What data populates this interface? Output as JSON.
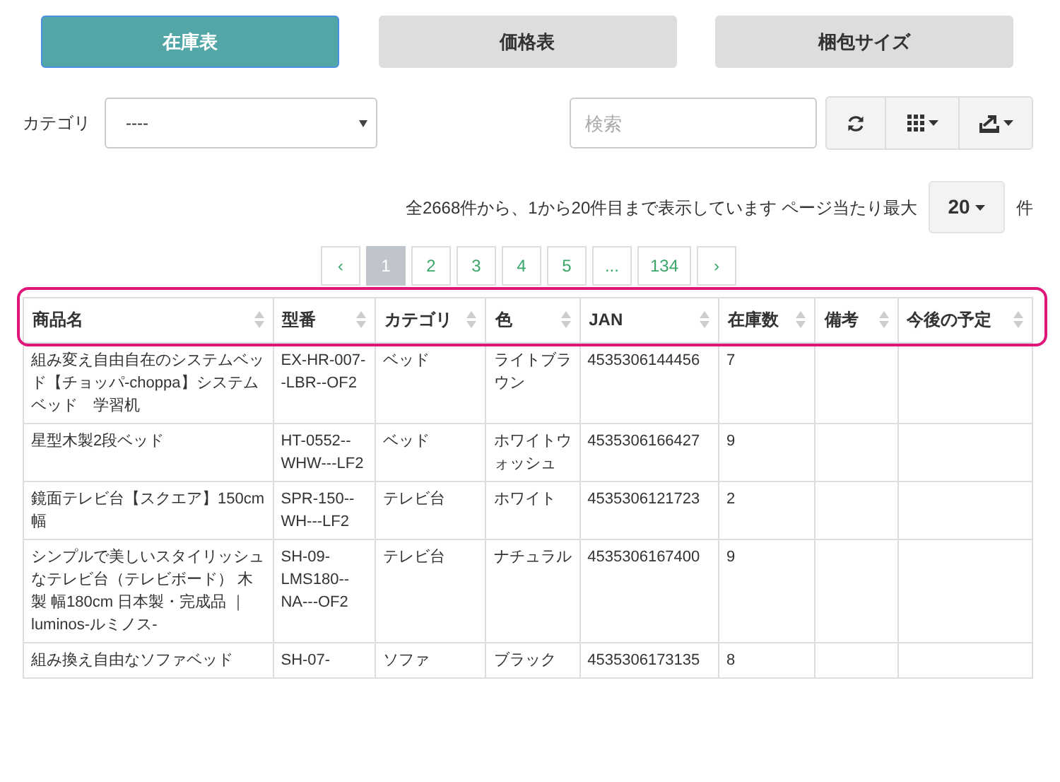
{
  "tabs": [
    {
      "label": "在庫表",
      "selected": true
    },
    {
      "label": "価格表",
      "selected": false
    },
    {
      "label": "梱包サイズ",
      "selected": false
    }
  ],
  "filter": {
    "label": "カテゴリ",
    "value": "----"
  },
  "search": {
    "placeholder": "検索"
  },
  "summary": {
    "text": "全2668件から、1から20件目まで表示しています ページ当たり最大",
    "page_size": "20",
    "unit": "件"
  },
  "pagination": [
    {
      "label": "‹",
      "selected": false
    },
    {
      "label": "1",
      "selected": true
    },
    {
      "label": "2",
      "selected": false
    },
    {
      "label": "3",
      "selected": false
    },
    {
      "label": "4",
      "selected": false
    },
    {
      "label": "5",
      "selected": false
    },
    {
      "label": "...",
      "selected": false
    },
    {
      "label": "134",
      "selected": false
    },
    {
      "label": "›",
      "selected": false
    }
  ],
  "table": {
    "header_highlighted": true,
    "columns": [
      "商品名",
      "型番",
      "カテゴリ",
      "色",
      "JAN",
      "在庫数",
      "備考",
      "今後の予定"
    ],
    "rows": [
      [
        "組み変え自由自在のシステムベッド【チョッパ-choppa】システムベッド　学習机",
        "EX-HR-007--LBR--OF2",
        "ベッド",
        "ライトブラウン",
        "4535306144456",
        "7",
        "",
        ""
      ],
      [
        "星型木製2段ベッド",
        "HT-0552--WHW---LF2",
        "ベッド",
        "ホワイトウォッシュ",
        "4535306166427",
        "9",
        "",
        ""
      ],
      [
        "鏡面テレビ台【スクエア】150cm幅",
        "SPR-150--WH---LF2",
        "テレビ台",
        "ホワイト",
        "4535306121723",
        "2",
        "",
        ""
      ],
      [
        "シンプルで美しいスタイリッシュなテレビ台（テレビボード） 木製 幅180cm 日本製・完成品 ｜luminos-ルミノス-",
        "SH-09-LMS180--NA---OF2",
        "テレビ台",
        "ナチュラル",
        "4535306167400",
        "9",
        "",
        ""
      ],
      [
        "組み換え自由なソファベッド",
        "SH-07-",
        "ソファ",
        "ブラック",
        "4535306173135",
        "8",
        "",
        ""
      ]
    ]
  }
}
